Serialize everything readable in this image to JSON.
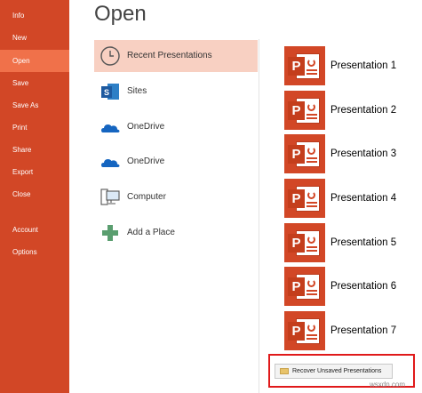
{
  "nav": {
    "items": [
      {
        "label": "Info",
        "name": "nav-info"
      },
      {
        "label": "New",
        "name": "nav-new"
      },
      {
        "label": "Open",
        "name": "nav-open"
      },
      {
        "label": "Save",
        "name": "nav-save"
      },
      {
        "label": "Save As",
        "name": "nav-save-as"
      },
      {
        "label": "Print",
        "name": "nav-print"
      },
      {
        "label": "Share",
        "name": "nav-share"
      },
      {
        "label": "Export",
        "name": "nav-export"
      },
      {
        "label": "Close",
        "name": "nav-close"
      },
      {
        "label": "Account",
        "name": "nav-account"
      },
      {
        "label": "Options",
        "name": "nav-options"
      }
    ],
    "active": "Open"
  },
  "page": {
    "title": "Open"
  },
  "places": [
    {
      "label": "Recent Presentations",
      "icon": "clock-icon"
    },
    {
      "label": "Sites",
      "icon": "sharepoint-icon"
    },
    {
      "label": "OneDrive",
      "icon": "cloud-icon"
    },
    {
      "label": "OneDrive",
      "icon": "cloud-icon"
    },
    {
      "label": "Computer",
      "icon": "computer-icon"
    },
    {
      "label": "Add a Place",
      "icon": "plus-icon"
    }
  ],
  "recent": [
    {
      "label": "Presentation 1"
    },
    {
      "label": "Presentation 2"
    },
    {
      "label": "Presentation 3"
    },
    {
      "label": "Presentation 4"
    },
    {
      "label": "Presentation 5"
    },
    {
      "label": "Presentation 6"
    },
    {
      "label": "Presentation 7"
    }
  ],
  "recover": {
    "label": "Recover Unsaved Presentations"
  },
  "watermark": "wsxdn.com",
  "colors": {
    "accent": "#d24726",
    "active_nav": "#f0714a",
    "highlight": "#f8d0c2",
    "frame": "#e0191a"
  }
}
